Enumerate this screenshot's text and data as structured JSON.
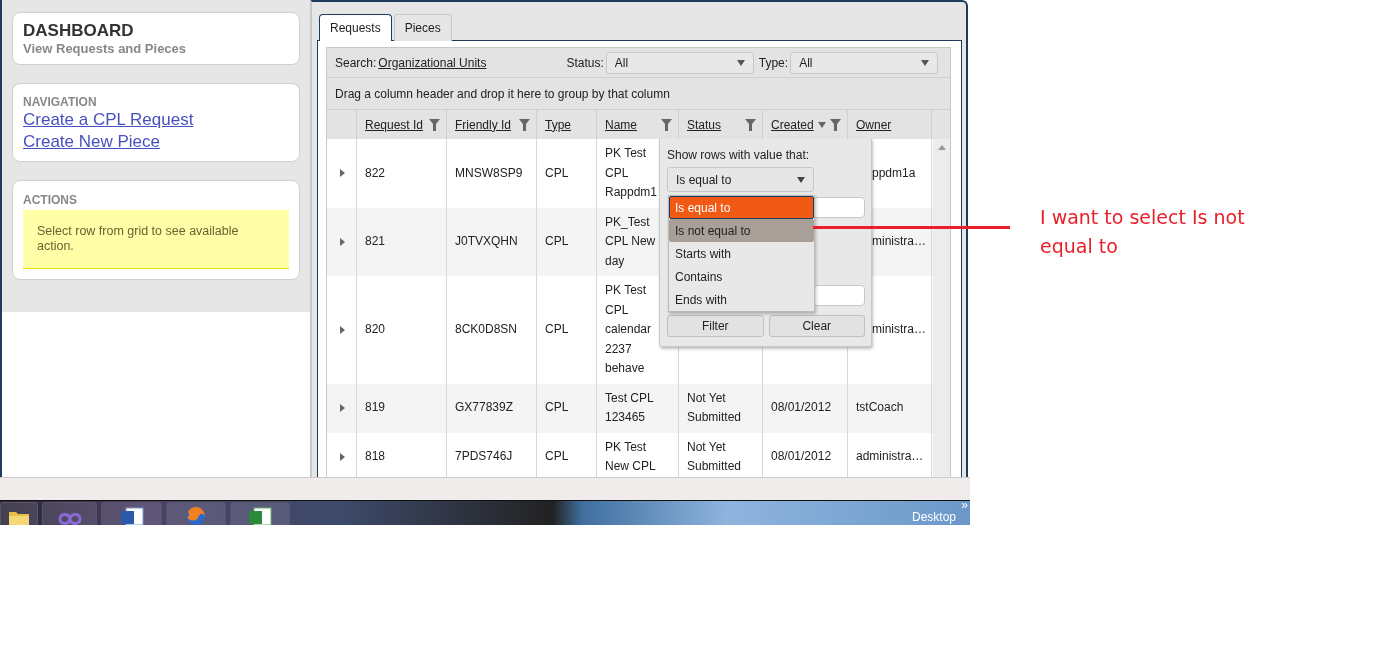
{
  "sidebar": {
    "header": {
      "title": "DASHBOARD",
      "subtitle": "View Requests and Pieces"
    },
    "navigation": {
      "heading": "NAVIGATION",
      "links": [
        "Create a CPL Request",
        "Create New Piece"
      ]
    },
    "actions": {
      "heading": "ACTIONS",
      "message": "Select row from grid to see available action."
    }
  },
  "tabs": [
    {
      "label": "Requests",
      "selected": true
    },
    {
      "label": "Pieces",
      "selected": false
    }
  ],
  "toolbar": {
    "search_label": "Search:",
    "search_link": "Organizational Units",
    "filters": [
      {
        "label": "Status:",
        "value": "All"
      },
      {
        "label": "Type:",
        "value": "All"
      }
    ]
  },
  "group_hint": "Drag a column header and drop it here to group by that column",
  "columns": [
    {
      "label": "Request Id",
      "filter": true,
      "sorted": false
    },
    {
      "label": "Friendly Id",
      "filter": true,
      "sorted": false
    },
    {
      "label": "Type",
      "filter": false,
      "sorted": false
    },
    {
      "label": "Name",
      "filter": true,
      "sorted": false
    },
    {
      "label": "Status",
      "filter": true,
      "sorted": false
    },
    {
      "label": "Created",
      "filter": true,
      "sorted": true
    },
    {
      "label": "Owner",
      "filter": false,
      "sorted": false
    }
  ],
  "rows": [
    {
      "request_id": "822",
      "friendly_id": "MNSW8SP9",
      "type": "CPL",
      "name": "PK Test CPL Rappdm1",
      "owner": "ppdm1a",
      "covered": true
    },
    {
      "request_id": "821",
      "friendly_id": "J0TVXQHN",
      "type": "CPL",
      "name": "PK_Test CPL New day",
      "owner": "ministra…",
      "covered": true
    },
    {
      "request_id": "820",
      "friendly_id": "8CK0D8SN",
      "type": "CPL",
      "name": "PK Test CPL calendar 2237 behave",
      "owner": "ministra…",
      "covered": true
    },
    {
      "request_id": "819",
      "friendly_id": "GX77839Z",
      "type": "CPL",
      "name": "Test CPL 123465",
      "status": "Not Yet Submitted",
      "created": "08/01/2012",
      "owner": "tstCoach",
      "covered": false
    },
    {
      "request_id": "818",
      "friendly_id": "7PDS746J",
      "type": "CPL",
      "name": "PK Test New CPL",
      "status": "Not Yet Submitted",
      "created": "08/01/2012",
      "owner": "administra…",
      "covered": false
    }
  ],
  "filter_popup": {
    "prompt": "Show rows with value that:",
    "operator": "Is equal to",
    "options": [
      {
        "label": "Is equal to",
        "selected": true,
        "hovered": false
      },
      {
        "label": "Is not equal to",
        "selected": false,
        "hovered": true
      },
      {
        "label": "Starts with",
        "selected": false,
        "hovered": false
      },
      {
        "label": "Contains",
        "selected": false,
        "hovered": false
      },
      {
        "label": "Ends with",
        "selected": false,
        "hovered": false
      }
    ],
    "buttons": [
      "Filter",
      "Clear"
    ]
  },
  "annotation": {
    "text": "I want to select Is not equal to"
  },
  "taskbar": {
    "apps": [
      {
        "kind": "folder"
      },
      {
        "kind": "swirl"
      },
      {
        "kind": "document"
      },
      {
        "kind": "browser"
      },
      {
        "kind": "spreadsheet"
      }
    ],
    "overflow": "»",
    "desktop_label": "Desktop"
  }
}
